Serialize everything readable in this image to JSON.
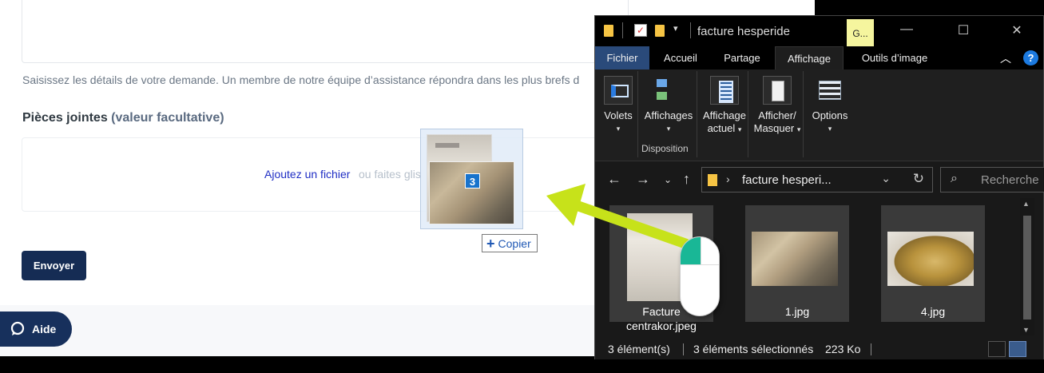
{
  "web_form": {
    "help_text": "Saisissez les détails de votre demande. Un membre de notre équipe d’assistance répondra dans les plus brefs d",
    "attachments_label": "Pièces jointes",
    "attachments_optional": "(valeur facultative)",
    "dropzone_link": "Ajoutez un fichier",
    "dropzone_rest": "ou faites glis",
    "submit_label": "Envoyer",
    "help_button_label": "Aide",
    "accent_color": "#152c54"
  },
  "drag": {
    "count": "3",
    "tooltip": "Copier",
    "arrow_color": "#c7e21a"
  },
  "explorer": {
    "title": "facture hesperide",
    "title_badge": "G...",
    "tabs": [
      "Fichier",
      "Accueil",
      "Partage",
      "Affichage",
      "Outils d’image"
    ],
    "active_tab": "Affichage",
    "ribbon": {
      "volets": "Volets",
      "affichages": "Affichages",
      "disposition": "Disposition",
      "affichage_actuel_1": "Affichage",
      "affichage_actuel_2": "actuel",
      "afficher_1": "Afficher/",
      "afficher_2": "Masquer",
      "options": "Options"
    },
    "address_path": "facture hesperi...",
    "search_placeholder": "Recherche",
    "files": [
      {
        "name_line1": "Facture",
        "name_line2": "centrakor.jpeg",
        "icon": "document-scan-thumbnail"
      },
      {
        "name_line1": "1.jpg",
        "name_line2": "",
        "icon": "box-photo-thumbnail"
      },
      {
        "name_line1": "4.jpg",
        "name_line2": "",
        "icon": "lamp-photo-thumbnail"
      }
    ],
    "status": {
      "items": "3 élément(s)",
      "selected": "3 éléments sélectionnés",
      "size": "223 Ko"
    }
  }
}
